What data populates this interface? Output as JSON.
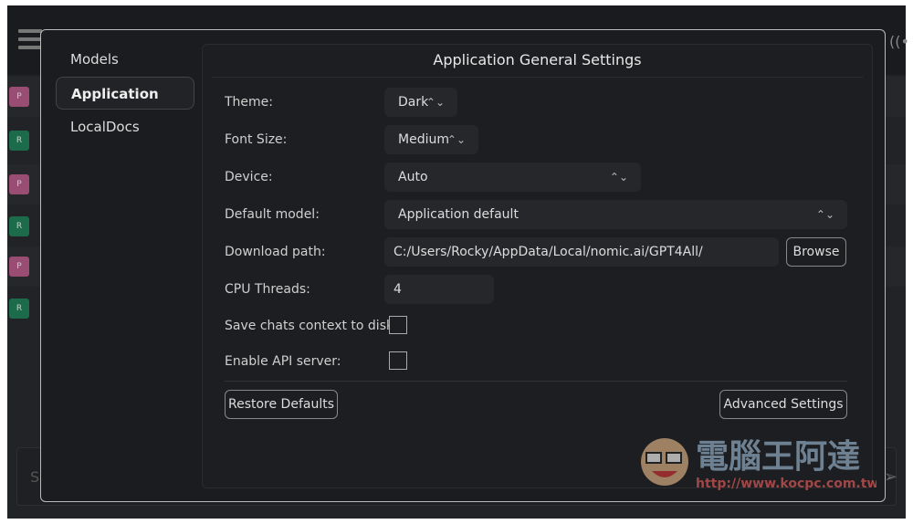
{
  "background_app": {
    "chat_badges": [
      "P",
      "R",
      "P",
      "R",
      "P",
      "R"
    ],
    "input_placeholder": "S",
    "colors": {
      "badge_p": "#9a4d73",
      "badge_r": "#1c6b4a"
    }
  },
  "dialog": {
    "nav": [
      {
        "label": "Models"
      },
      {
        "label": "Application",
        "active": true
      },
      {
        "label": "LocalDocs"
      }
    ],
    "title": "Application General Settings",
    "settings": {
      "theme": {
        "label": "Theme:",
        "value": "Dark"
      },
      "font_size": {
        "label": "Font Size:",
        "value": "Medium"
      },
      "device": {
        "label": "Device:",
        "value": "Auto"
      },
      "default_model": {
        "label": "Default model:",
        "value": "Application default"
      },
      "download_path": {
        "label": "Download path:",
        "value": "C:/Users/Rocky/AppData/Local/nomic.ai/GPT4All/",
        "browse": "Browse"
      },
      "cpu_threads": {
        "label": "CPU Threads:",
        "value": "4"
      },
      "save_context": {
        "label": "Save chats context to disk:",
        "checked": false
      },
      "api_server": {
        "label": "Enable API server:",
        "checked": false
      }
    },
    "restore_defaults": "Restore Defaults",
    "advanced_settings": "Advanced Settings"
  },
  "watermark": {
    "title": "電腦王阿達",
    "url": "http://www.kocpc.com.tw"
  }
}
